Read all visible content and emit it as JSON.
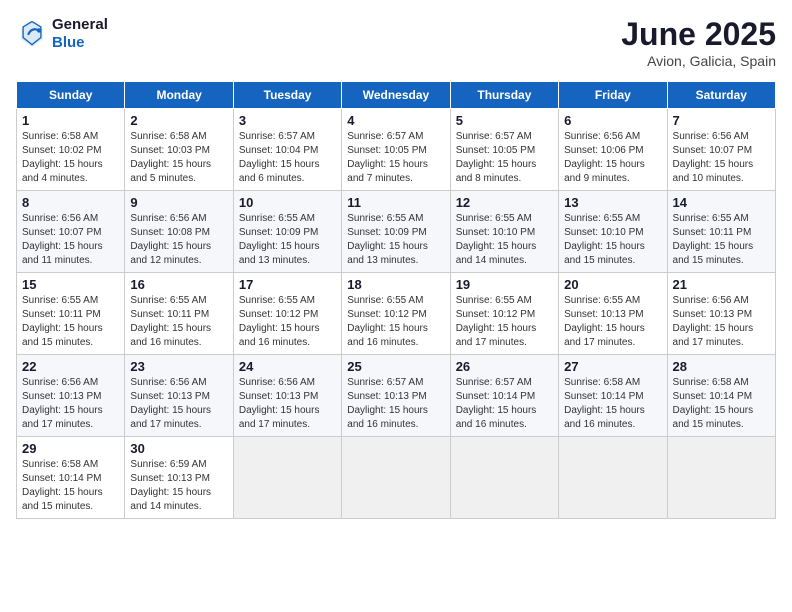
{
  "header": {
    "logo_line1": "General",
    "logo_line2": "Blue",
    "month_year": "June 2025",
    "location": "Avion, Galicia, Spain"
  },
  "weekdays": [
    "Sunday",
    "Monday",
    "Tuesday",
    "Wednesday",
    "Thursday",
    "Friday",
    "Saturday"
  ],
  "weeks": [
    [
      {
        "day": 1,
        "sunrise": "6:58 AM",
        "sunset": "10:02 PM",
        "daylight": "15 hours and 4 minutes."
      },
      {
        "day": 2,
        "sunrise": "6:58 AM",
        "sunset": "10:03 PM",
        "daylight": "15 hours and 5 minutes."
      },
      {
        "day": 3,
        "sunrise": "6:57 AM",
        "sunset": "10:04 PM",
        "daylight": "15 hours and 6 minutes."
      },
      {
        "day": 4,
        "sunrise": "6:57 AM",
        "sunset": "10:05 PM",
        "daylight": "15 hours and 7 minutes."
      },
      {
        "day": 5,
        "sunrise": "6:57 AM",
        "sunset": "10:05 PM",
        "daylight": "15 hours and 8 minutes."
      },
      {
        "day": 6,
        "sunrise": "6:56 AM",
        "sunset": "10:06 PM",
        "daylight": "15 hours and 9 minutes."
      },
      {
        "day": 7,
        "sunrise": "6:56 AM",
        "sunset": "10:07 PM",
        "daylight": "15 hours and 10 minutes."
      }
    ],
    [
      {
        "day": 8,
        "sunrise": "6:56 AM",
        "sunset": "10:07 PM",
        "daylight": "15 hours and 11 minutes."
      },
      {
        "day": 9,
        "sunrise": "6:56 AM",
        "sunset": "10:08 PM",
        "daylight": "15 hours and 12 minutes."
      },
      {
        "day": 10,
        "sunrise": "6:55 AM",
        "sunset": "10:09 PM",
        "daylight": "15 hours and 13 minutes."
      },
      {
        "day": 11,
        "sunrise": "6:55 AM",
        "sunset": "10:09 PM",
        "daylight": "15 hours and 13 minutes."
      },
      {
        "day": 12,
        "sunrise": "6:55 AM",
        "sunset": "10:10 PM",
        "daylight": "15 hours and 14 minutes."
      },
      {
        "day": 13,
        "sunrise": "6:55 AM",
        "sunset": "10:10 PM",
        "daylight": "15 hours and 15 minutes."
      },
      {
        "day": 14,
        "sunrise": "6:55 AM",
        "sunset": "10:11 PM",
        "daylight": "15 hours and 15 minutes."
      }
    ],
    [
      {
        "day": 15,
        "sunrise": "6:55 AM",
        "sunset": "10:11 PM",
        "daylight": "15 hours and 15 minutes."
      },
      {
        "day": 16,
        "sunrise": "6:55 AM",
        "sunset": "10:11 PM",
        "daylight": "15 hours and 16 minutes."
      },
      {
        "day": 17,
        "sunrise": "6:55 AM",
        "sunset": "10:12 PM",
        "daylight": "15 hours and 16 minutes."
      },
      {
        "day": 18,
        "sunrise": "6:55 AM",
        "sunset": "10:12 PM",
        "daylight": "15 hours and 16 minutes."
      },
      {
        "day": 19,
        "sunrise": "6:55 AM",
        "sunset": "10:12 PM",
        "daylight": "15 hours and 17 minutes."
      },
      {
        "day": 20,
        "sunrise": "6:55 AM",
        "sunset": "10:13 PM",
        "daylight": "15 hours and 17 minutes."
      },
      {
        "day": 21,
        "sunrise": "6:56 AM",
        "sunset": "10:13 PM",
        "daylight": "15 hours and 17 minutes."
      }
    ],
    [
      {
        "day": 22,
        "sunrise": "6:56 AM",
        "sunset": "10:13 PM",
        "daylight": "15 hours and 17 minutes."
      },
      {
        "day": 23,
        "sunrise": "6:56 AM",
        "sunset": "10:13 PM",
        "daylight": "15 hours and 17 minutes."
      },
      {
        "day": 24,
        "sunrise": "6:56 AM",
        "sunset": "10:13 PM",
        "daylight": "15 hours and 17 minutes."
      },
      {
        "day": 25,
        "sunrise": "6:57 AM",
        "sunset": "10:13 PM",
        "daylight": "15 hours and 16 minutes."
      },
      {
        "day": 26,
        "sunrise": "6:57 AM",
        "sunset": "10:14 PM",
        "daylight": "15 hours and 16 minutes."
      },
      {
        "day": 27,
        "sunrise": "6:58 AM",
        "sunset": "10:14 PM",
        "daylight": "15 hours and 16 minutes."
      },
      {
        "day": 28,
        "sunrise": "6:58 AM",
        "sunset": "10:14 PM",
        "daylight": "15 hours and 15 minutes."
      }
    ],
    [
      {
        "day": 29,
        "sunrise": "6:58 AM",
        "sunset": "10:14 PM",
        "daylight": "15 hours and 15 minutes."
      },
      {
        "day": 30,
        "sunrise": "6:59 AM",
        "sunset": "10:13 PM",
        "daylight": "15 hours and 14 minutes."
      },
      null,
      null,
      null,
      null,
      null
    ]
  ]
}
